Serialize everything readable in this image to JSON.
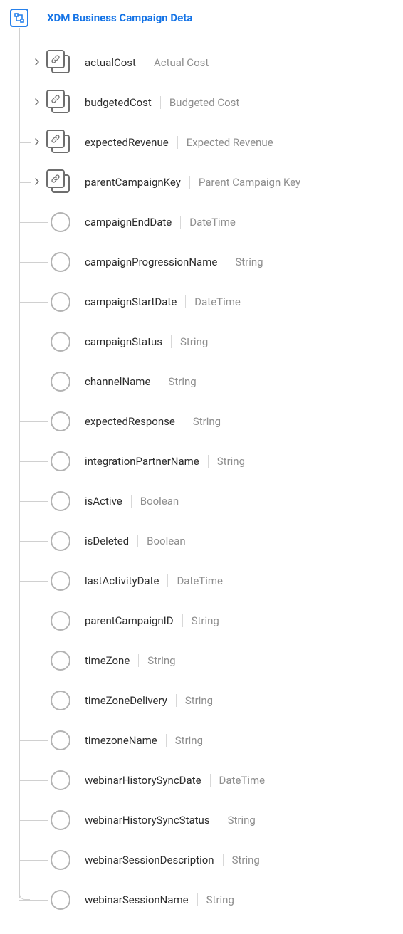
{
  "root": {
    "label": "XDM Business Campaign Deta"
  },
  "objectNodes": [
    {
      "name": "actualCost",
      "display": "Actual Cost"
    },
    {
      "name": "budgetedCost",
      "display": "Budgeted Cost"
    },
    {
      "name": "expectedRevenue",
      "display": "Expected Revenue"
    },
    {
      "name": "parentCampaignKey",
      "display": "Parent Campaign Key"
    }
  ],
  "leafNodes": [
    {
      "name": "campaignEndDate",
      "type": "DateTime"
    },
    {
      "name": "campaignProgressionName",
      "type": "String"
    },
    {
      "name": "campaignStartDate",
      "type": "DateTime"
    },
    {
      "name": "campaignStatus",
      "type": "String"
    },
    {
      "name": "channelName",
      "type": "String"
    },
    {
      "name": "expectedResponse",
      "type": "String"
    },
    {
      "name": "integrationPartnerName",
      "type": "String"
    },
    {
      "name": "isActive",
      "type": "Boolean"
    },
    {
      "name": "isDeleted",
      "type": "Boolean"
    },
    {
      "name": "lastActivityDate",
      "type": "DateTime"
    },
    {
      "name": "parentCampaignID",
      "type": "String"
    },
    {
      "name": "timeZone",
      "type": "String"
    },
    {
      "name": "timeZoneDelivery",
      "type": "String"
    },
    {
      "name": "timezoneName",
      "type": "String"
    },
    {
      "name": "webinarHistorySyncDate",
      "type": "DateTime"
    },
    {
      "name": "webinarHistorySyncStatus",
      "type": "String"
    },
    {
      "name": "webinarSessionDescription",
      "type": "String"
    },
    {
      "name": "webinarSessionName",
      "type": "String"
    }
  ]
}
